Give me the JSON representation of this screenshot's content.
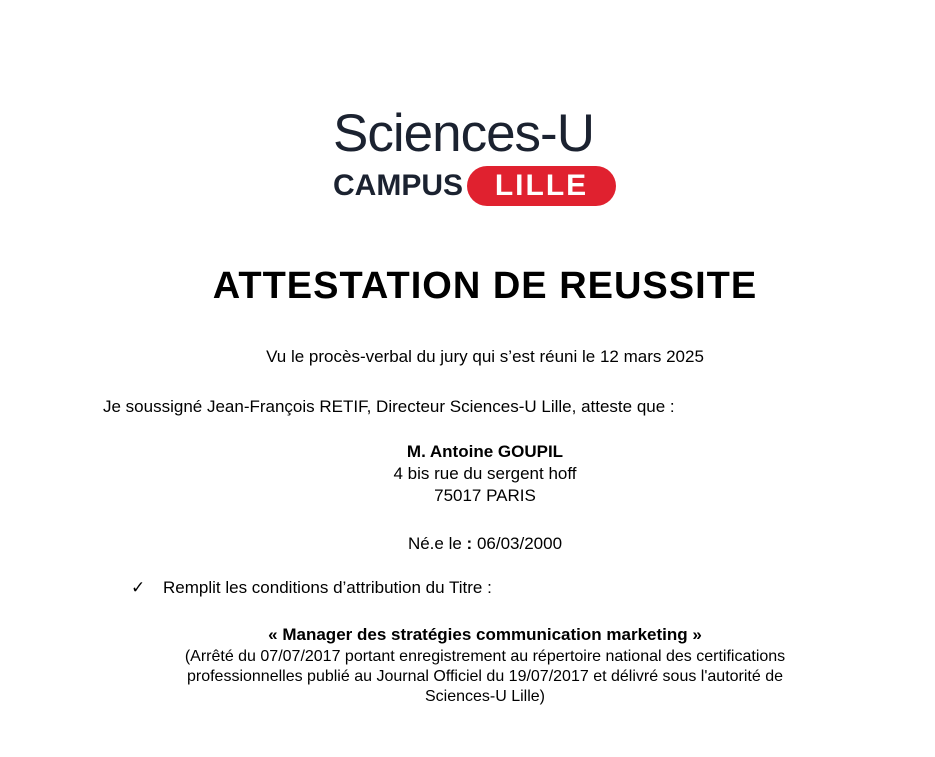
{
  "logo": {
    "line1": "Sciences-U",
    "campus": "CAMPUS",
    "city": "LILLE",
    "colors": {
      "dark": "#1b2230",
      "red": "#e0212f"
    }
  },
  "title": "ATTESTATION DE REUSSITE",
  "intro": "Vu le procès-verbal du jury qui s’est réuni le 12 mars 2025",
  "statement": "Je soussigné Jean-François RETIF, Directeur Sciences-U Lille, atteste que :",
  "recipient": {
    "name": "M. Antoine GOUPIL",
    "address_line1": "4 bis rue du sergent hoff",
    "address_line2": "75017 PARIS"
  },
  "birth": {
    "label": "Né.e le ",
    "colon": ":",
    "date": " 06/03/2000"
  },
  "condition": {
    "check_icon": "✓",
    "text": "Remplit les conditions d’attribution du Titre :"
  },
  "title_name": "« Manager des stratégies communication marketing »",
  "legal": {
    "line1": "(Arrêté du 07/07/2017 portant enregistrement au répertoire national des certifications",
    "line2": "professionnelles publié au Journal Officiel du 19/07/2017 et délivré sous l'autorité de",
    "line3": "Sciences-U Lille)"
  }
}
